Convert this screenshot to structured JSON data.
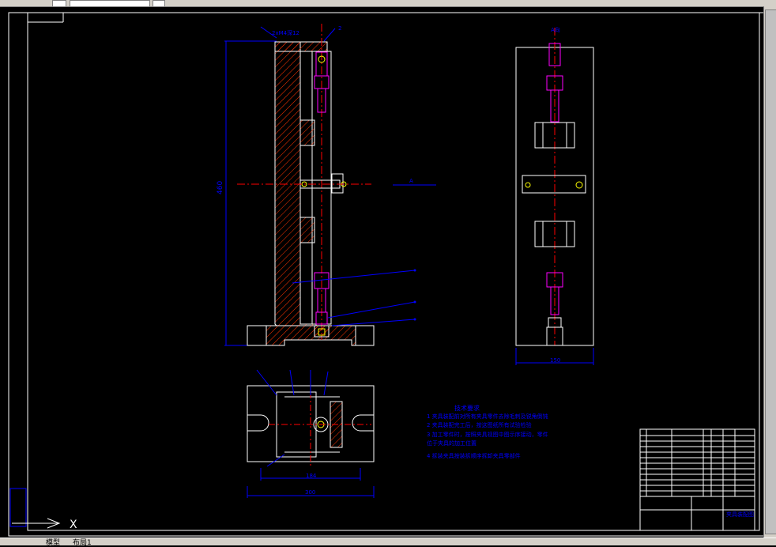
{
  "app": {
    "statusbar_tab": "模型",
    "statusbar_tab2": "布局1"
  },
  "drawing": {
    "front_view": {
      "overall_height_dim": "460",
      "section_label": "A",
      "top_label": "2xM4深12",
      "top_right_label": "2"
    },
    "side_view": {
      "width_dim": "150",
      "top_label": "A向"
    },
    "bottom_view": {
      "width_dim_1": "184",
      "width_dim_2": "300"
    },
    "tech_requirements": {
      "heading": "技术要求",
      "items": [
        "1  夹具装配前对所有夹具零件去除毛刺及锐角倒钝",
        "2  夹具装配完工后，按这图纸所有试验检验",
        "3  加工零件时，按照夹具视图中图示序接动，零件",
        "    位于夹具的加工位置",
        "4  拆装夹具按装拆顺序拆卸夹具零部件"
      ]
    },
    "title_block": {
      "drawing_title": "夹具装配图"
    },
    "colors": {
      "background": "#000000",
      "outline": "#ffffff",
      "dimension": "#0000ff",
      "part": "#ff00ff",
      "hatch": "#ff3300",
      "center": "#ff0000"
    }
  }
}
